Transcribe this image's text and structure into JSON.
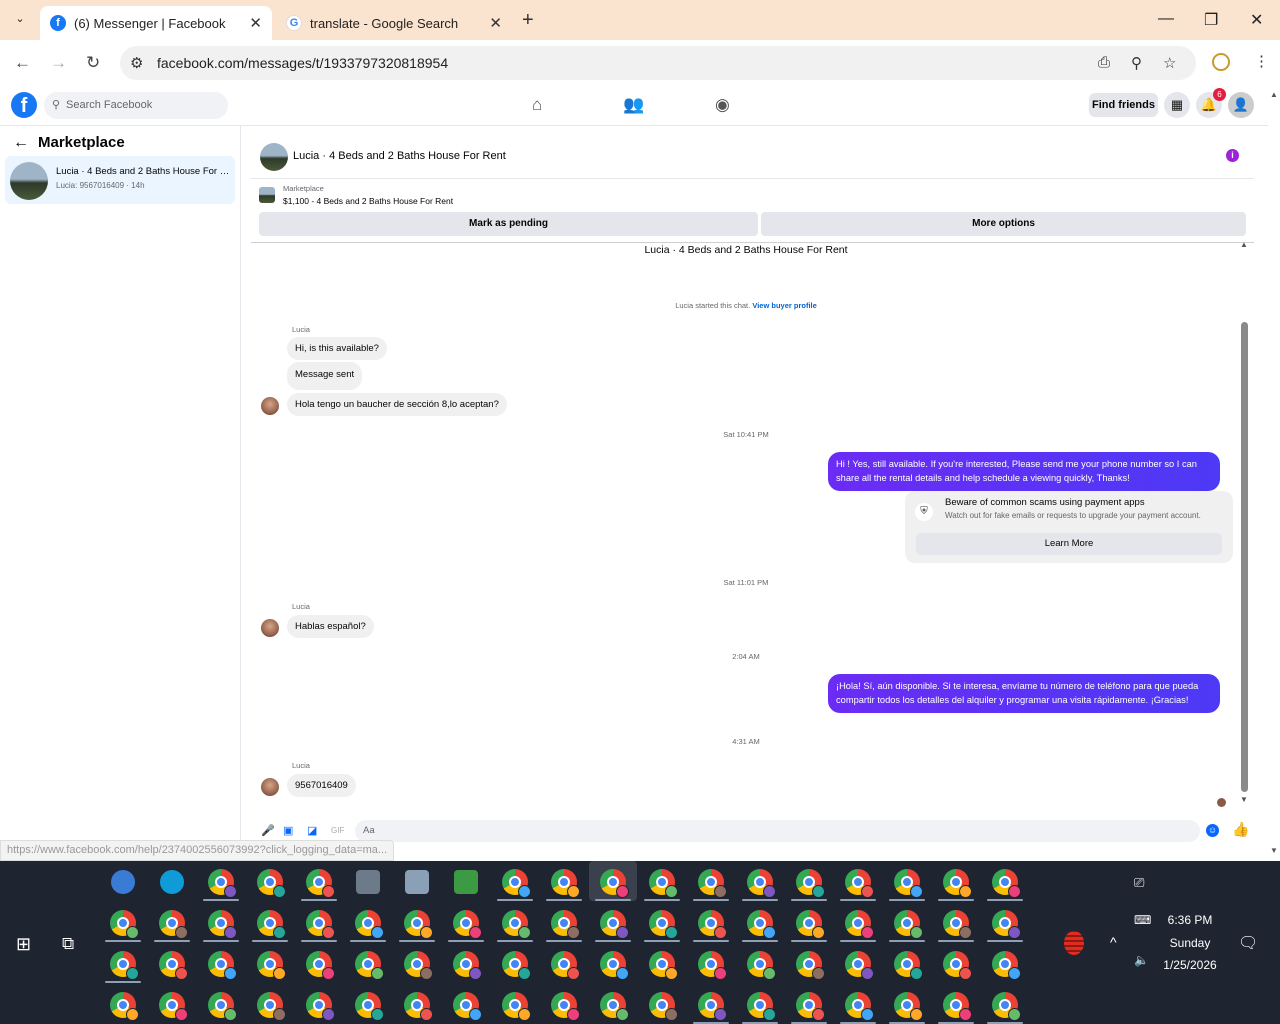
{
  "browser": {
    "tabs": [
      {
        "title": "(6) Messenger | Facebook",
        "favicon": "facebook-icon",
        "active": true
      },
      {
        "title": "translate - Google Search",
        "favicon": "google-icon",
        "active": false
      }
    ],
    "url": "facebook.com/messages/t/1933797320818954",
    "status_url": "https://www.facebook.com/help/2374002556073992?click_logging_data=ma..."
  },
  "fb_header": {
    "search_placeholder": "Search Facebook",
    "find_friends_label": "Find friends",
    "notification_count": "6"
  },
  "left_panel": {
    "title": "Marketplace",
    "conversation": {
      "title": "Lucia · 4 Beds and 2 Baths House For Rent",
      "subtitle": "Lucia: 9567016409 · 14h"
    }
  },
  "chat": {
    "header_title": "Lucia · 4 Beds and 2 Baths House For Rent",
    "listing": {
      "label": "Marketplace",
      "price_title": "$1,100 - 4 Beds and 2 Baths House For Rent",
      "mark_pending": "Mark as pending",
      "more_options": "More options"
    },
    "thread_title": "Lucia · 4 Beds and 2 Baths House For Rent",
    "started_text": "Lucia started this chat.",
    "view_profile": "View buyer profile",
    "sender_name": "Lucia",
    "msg1": "Hi, is this available?",
    "msg2": "Message sent",
    "msg3": "Hola tengo un baucher de sección 8,lo aceptan?",
    "ts1": "Sat 10:41 PM",
    "out1": "Hi ! Yes, still available. If you're interested, Please send me your phone number so I can share all the rental details and help schedule a viewing quickly, Thanks!",
    "scam_title": "Beware of common scams using payment apps",
    "scam_text": "Watch out for fake emails or requests to upgrade your payment account.",
    "learn_more": "Learn More",
    "ts2": "Sat 11:01 PM",
    "msg4": "Hablas español?",
    "ts3": "2:04 AM",
    "out2": "¡Hola! Sí, aún disponible. Si te interesa, envíame tu número de teléfono para que pueda compartir todos los detalles del alquiler y programar una visita rápidamente. ¡Gracias!",
    "ts4": "4:31 AM",
    "msg5": "9567016409",
    "input_placeholder": "Aa"
  },
  "taskbar": {
    "time": "6:36 PM",
    "day": "Sunday",
    "date": "1/25/2026"
  },
  "colors": {
    "facebook_blue": "#1877f2",
    "messenger_purple": "#6b2cf5",
    "tab_bar": "#fbe4cf",
    "taskbar": "#1f2530"
  }
}
